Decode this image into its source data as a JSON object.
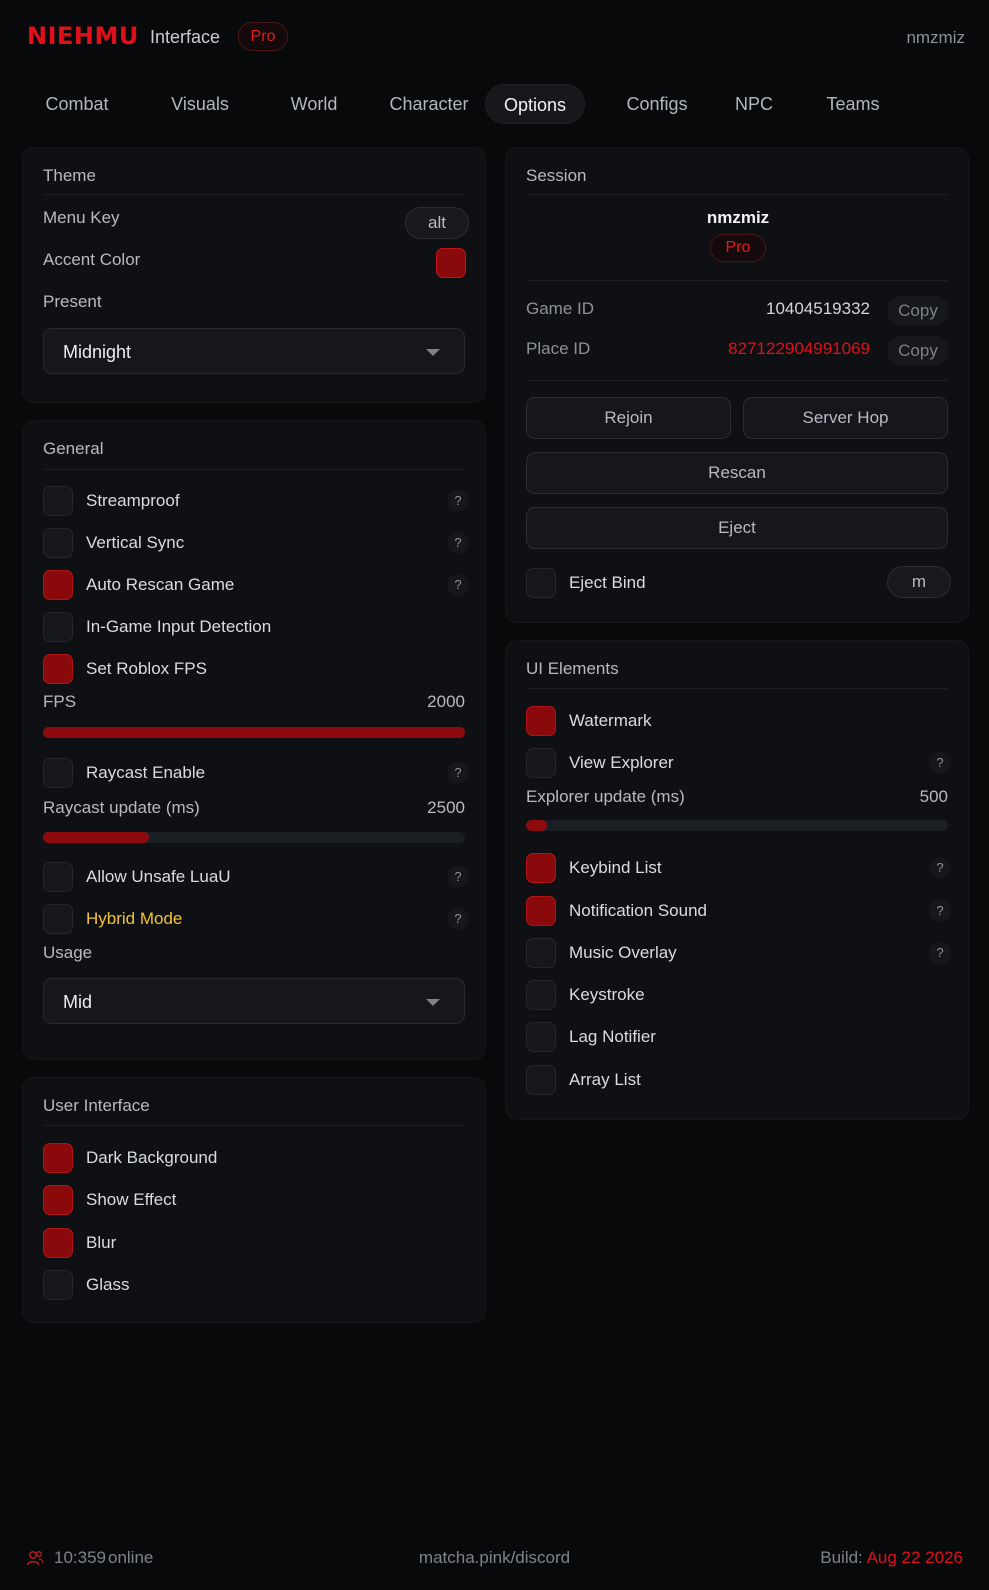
{
  "header": {
    "logo": "NIEHMU",
    "title": "Interface",
    "badge": "Pro",
    "username": "nmzmiz"
  },
  "tabs": [
    {
      "label": "Combat",
      "active": false
    },
    {
      "label": "Visuals",
      "active": false
    },
    {
      "label": "World",
      "active": false
    },
    {
      "label": "Character",
      "active": false
    },
    {
      "label": "Options",
      "active": true
    },
    {
      "label": "Configs",
      "active": false
    },
    {
      "label": "NPC",
      "active": false
    },
    {
      "label": "Teams",
      "active": false
    }
  ],
  "theme": {
    "title": "Theme",
    "menu_key_label": "Menu Key",
    "menu_key_value": "alt",
    "accent_label": "Accent Color",
    "accent_color": "#8a0a0c",
    "preset_label": "Present",
    "preset_value": "Midnight"
  },
  "general": {
    "title": "General",
    "streamproof": {
      "label": "Streamproof",
      "checked": false
    },
    "vsync": {
      "label": "Vertical Sync",
      "checked": false
    },
    "auto_rescan": {
      "label": "Auto Rescan Game",
      "checked": true
    },
    "input_detection": {
      "label": "In-Game Input Detection",
      "checked": false
    },
    "set_fps": {
      "label": "Set Roblox FPS",
      "checked": true
    },
    "fps": {
      "label": "FPS",
      "value": "2000",
      "fill": 1.0
    },
    "raycast": {
      "label": "Raycast Enable",
      "checked": false
    },
    "raycast_update": {
      "label": "Raycast update (ms)",
      "value": "2500",
      "fill": 0.25
    },
    "unsafe_luau": {
      "label": "Allow Unsafe LuaU",
      "checked": false
    },
    "hybrid_mode": {
      "label": "Hybrid Mode",
      "checked": false,
      "color": "#f2c230"
    },
    "usage_label": "Usage",
    "usage_value": "Mid",
    "help_glyph": "?"
  },
  "user_interface": {
    "title": "User Interface",
    "dark_background": {
      "label": "Dark Background",
      "checked": true
    },
    "show_effect": {
      "label": "Show Effect",
      "checked": true
    },
    "blur": {
      "label": "Blur",
      "checked": true
    },
    "glass": {
      "label": "Glass",
      "checked": false
    }
  },
  "session": {
    "title": "Session",
    "username": "nmzmiz",
    "badge": "Pro",
    "game_id_label": "Game ID",
    "game_id": "10404519332",
    "place_id_label": "Place ID",
    "place_id": "827122904991069",
    "copy_label": "Copy",
    "rejoin": "Rejoin",
    "server_hop": "Server Hop",
    "rescan": "Rescan",
    "eject": "Eject",
    "eject_bind_label": "Eject Bind",
    "eject_bind_checked": false,
    "eject_bind_key": "m"
  },
  "ui_elements": {
    "title": "UI Elements",
    "watermark": {
      "label": "Watermark",
      "checked": true
    },
    "view_explorer": {
      "label": "View Explorer",
      "checked": false
    },
    "explorer_update": {
      "label": "Explorer update (ms)",
      "value": "500",
      "fill": 0.05
    },
    "keybind_list": {
      "label": "Keybind List",
      "checked": true
    },
    "notification_sound": {
      "label": "Notification Sound",
      "checked": true
    },
    "music_overlay": {
      "label": "Music Overlay",
      "checked": false
    },
    "keystroke": {
      "label": "Keystroke",
      "checked": false
    },
    "lag_notifier": {
      "label": "Lag Notifier",
      "checked": false
    },
    "array_list": {
      "label": "Array List",
      "checked": false
    }
  },
  "footer": {
    "online_count": "10:359",
    "online_suffix": "online",
    "link": "matcha.pink/discord",
    "build_label": "Build:",
    "build_date": "Aug 22 2026"
  },
  "colors": {
    "accent": "#e0101a",
    "checked": "#8a0a0c",
    "warning_text": "#f2c230",
    "background": "#08090b",
    "panel": "#0f1013"
  }
}
